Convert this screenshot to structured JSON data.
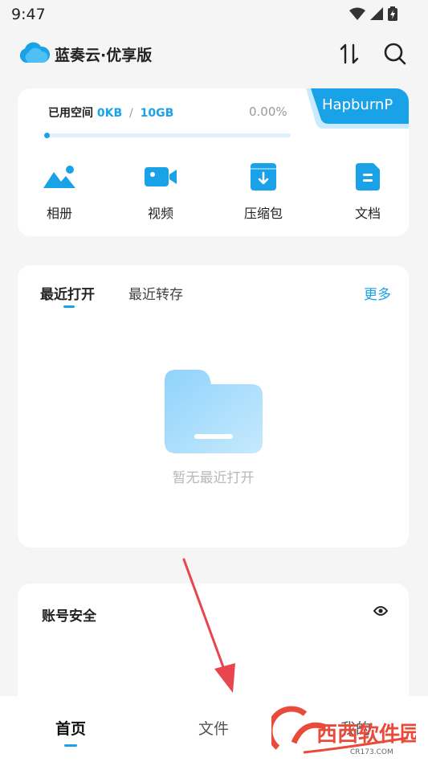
{
  "status_bar": {
    "time": "9:47"
  },
  "header": {
    "app_title": "蓝奏云·优享版"
  },
  "storage": {
    "label": "已用空间",
    "used": "0KB",
    "separator": "/",
    "total": "10GB",
    "percent": "0.00%",
    "progress_fraction": 0.0,
    "username": "HapburnP"
  },
  "quick_actions": [
    {
      "label": "相册",
      "icon": "album-icon"
    },
    {
      "label": "视频",
      "icon": "video-icon"
    },
    {
      "label": "压缩包",
      "icon": "archive-icon"
    },
    {
      "label": "文档",
      "icon": "document-icon"
    }
  ],
  "recent": {
    "tabs": [
      {
        "label": "最近打开"
      },
      {
        "label": "最近转存"
      }
    ],
    "more_label": "更多",
    "empty_text": "暂无最近打开"
  },
  "security": {
    "title": "账号安全"
  },
  "bottom_nav": [
    {
      "label": "首页"
    },
    {
      "label": "文件"
    },
    {
      "label": "我的"
    }
  ],
  "watermark": {
    "text": "西西软件园",
    "subtext": "CR173.COM"
  },
  "colors": {
    "accent": "#1aa2e8",
    "annotation_arrow": "#e8454f"
  }
}
